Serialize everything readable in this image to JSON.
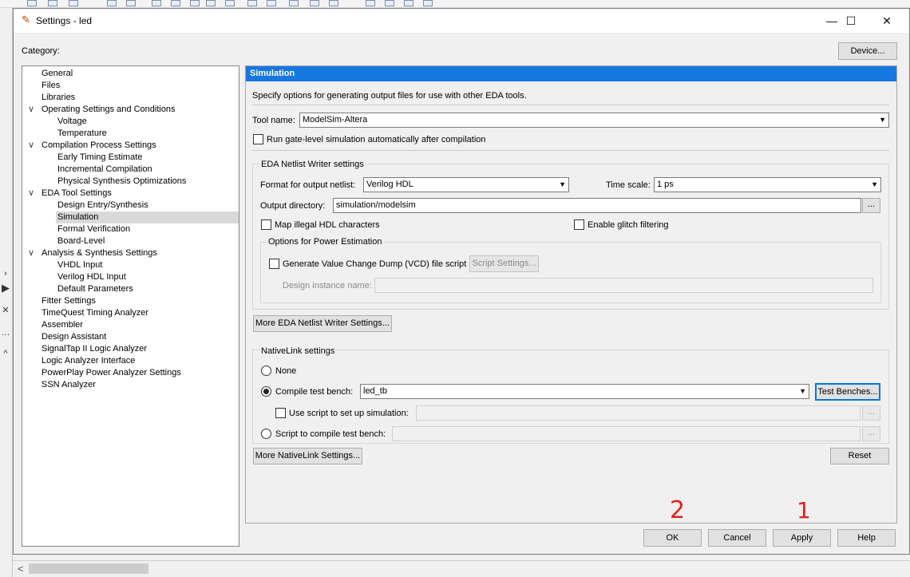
{
  "window": {
    "title": "Settings - led",
    "minimize": "—",
    "maximize": "☐",
    "close": "✕"
  },
  "category_label": "Category:",
  "device_button": "Device...",
  "tree": [
    {
      "label": "General",
      "level": 1
    },
    {
      "label": "Files",
      "level": 1
    },
    {
      "label": "Libraries",
      "level": 1
    },
    {
      "label": "Operating Settings and Conditions",
      "level": 1,
      "expanded": true
    },
    {
      "label": "Voltage",
      "level": 2
    },
    {
      "label": "Temperature",
      "level": 2
    },
    {
      "label": "Compilation Process Settings",
      "level": 1,
      "expanded": true
    },
    {
      "label": "Early Timing Estimate",
      "level": 2
    },
    {
      "label": "Incremental Compilation",
      "level": 2
    },
    {
      "label": "Physical Synthesis Optimizations",
      "level": 2
    },
    {
      "label": "EDA Tool Settings",
      "level": 1,
      "expanded": true
    },
    {
      "label": "Design Entry/Synthesis",
      "level": 2
    },
    {
      "label": "Simulation",
      "level": 2,
      "selected": true
    },
    {
      "label": "Formal Verification",
      "level": 2
    },
    {
      "label": "Board-Level",
      "level": 2
    },
    {
      "label": "Analysis & Synthesis Settings",
      "level": 1,
      "expanded": true
    },
    {
      "label": "VHDL Input",
      "level": 2
    },
    {
      "label": "Verilog HDL Input",
      "level": 2
    },
    {
      "label": "Default Parameters",
      "level": 2
    },
    {
      "label": "Fitter Settings",
      "level": 1
    },
    {
      "label": "TimeQuest Timing Analyzer",
      "level": 1
    },
    {
      "label": "Assembler",
      "level": 1
    },
    {
      "label": "Design Assistant",
      "level": 1
    },
    {
      "label": "SignalTap II Logic Analyzer",
      "level": 1
    },
    {
      "label": "Logic Analyzer Interface",
      "level": 1
    },
    {
      "label": "PowerPlay Power Analyzer Settings",
      "level": 1
    },
    {
      "label": "SSN Analyzer",
      "level": 1
    }
  ],
  "panel": {
    "header": "Simulation",
    "description": "Specify options for generating output files for use with other EDA tools.",
    "tool_name_label": "Tool name:",
    "tool_name_value": "ModelSim-Altera",
    "run_gate_level_label": "Run gate-level simulation automatically after compilation",
    "netlist_group_title": "EDA Netlist Writer settings",
    "format_label": "Format for output netlist:",
    "format_value": "Verilog HDL",
    "time_scale_label": "Time scale:",
    "time_scale_value": "1 ps",
    "output_dir_label": "Output directory:",
    "output_dir_value": "simulation/modelsim",
    "output_dir_browse": "...",
    "map_illegal_label": "Map illegal HDL characters",
    "glitch_label": "Enable glitch filtering",
    "power_group_title": "Options for Power Estimation",
    "vcd_label": "Generate Value Change Dump (VCD) file script",
    "script_settings_button": "Script Settings...",
    "design_instance_label": "Design instance name:",
    "design_instance_value": "",
    "more_netlist_button": "More EDA Netlist Writer Settings...",
    "nativelink_group_title": "NativeLink settings",
    "none_label": "None",
    "compile_tb_label": "Compile test bench:",
    "compile_tb_value": "led_tb",
    "test_benches_button": "Test Benches...",
    "use_script_label": "Use script to set up simulation:",
    "use_script_value": "",
    "use_script_browse": "...",
    "script_compile_label": "Script to compile test bench:",
    "script_compile_value": "",
    "script_compile_browse": "...",
    "more_nativelink_button": "More NativeLink Settings...",
    "reset_button": "Reset"
  },
  "footer": {
    "ok": "OK",
    "cancel": "Cancel",
    "apply": "Apply",
    "help": "Help"
  },
  "annotations": {
    "ok_mark": "2",
    "apply_mark": "1",
    "color": "#e02020"
  },
  "colors": {
    "header_blue": "#1677e0",
    "focus_blue": "#0078d7"
  }
}
